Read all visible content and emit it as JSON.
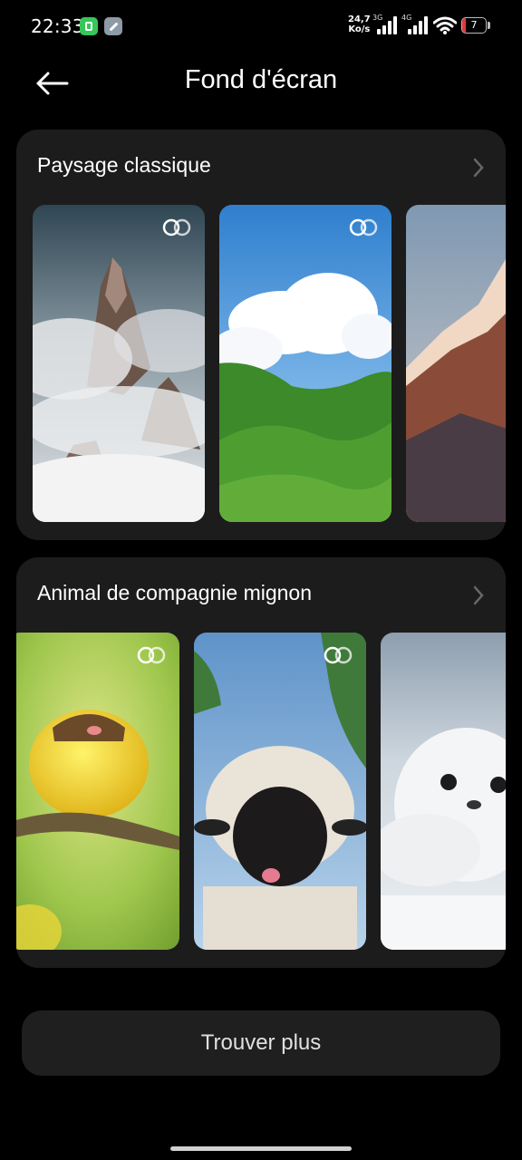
{
  "status_bar": {
    "time": "22:33",
    "net_speed_value": "24,7",
    "net_speed_unit": "Ko/s",
    "sim1_label": "3G",
    "sim2_label": "4G",
    "battery_level": "7",
    "icons": [
      "app-green-icon",
      "tool-icon",
      "signal-icon",
      "signal-icon",
      "wifi-icon",
      "battery-icon"
    ]
  },
  "header": {
    "title": "Fond d'écran",
    "back_icon": "arrow-left-icon"
  },
  "sections": [
    {
      "title": "Paysage classique",
      "items": [
        {
          "subject": "misty rocky peaks",
          "live": true
        },
        {
          "subject": "green hills with cloud",
          "live": true
        },
        {
          "subject": "snowy mountain at sunset",
          "live": false
        }
      ]
    },
    {
      "title": "Animal de compagnie mignon",
      "items": [
        {
          "subject": "yellow fluffy bird on branch",
          "live": true
        },
        {
          "subject": "black-faced sheep",
          "live": true
        },
        {
          "subject": "white seal pup on snow",
          "live": false
        }
      ]
    }
  ],
  "find_more_label": "Trouver plus",
  "colors": {
    "background": "#000000",
    "card": "#1c1c1c",
    "button": "#1f1f1f",
    "battery_low": "#e5373b"
  }
}
